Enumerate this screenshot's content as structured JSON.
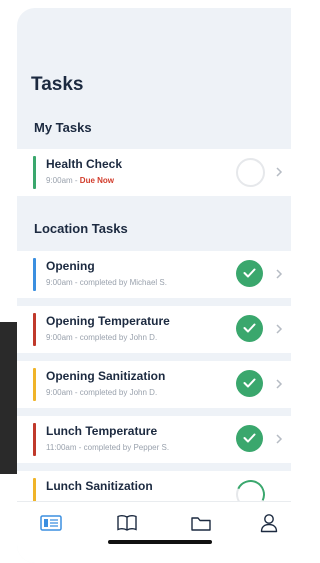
{
  "header": {
    "title": "Tasks"
  },
  "sections": {
    "my_tasks": {
      "title": "My Tasks",
      "items": [
        {
          "name": "Health Check",
          "time": "9:00am",
          "separator": " - ",
          "status_text": "Due Now",
          "status": "empty",
          "accent": "#3aa76d"
        }
      ]
    },
    "location_tasks": {
      "title": "Location Tasks",
      "items": [
        {
          "name": "Opening",
          "time": "9:00am",
          "detail": " - completed by Michael S.",
          "status": "done",
          "accent": "#3b8fe0"
        },
        {
          "name": "Opening Temperature",
          "time": "9:00am",
          "detail": " - completed by John D.",
          "status": "done",
          "accent": "#c0392b"
        },
        {
          "name": "Opening Sanitization",
          "time": "9:00am",
          "detail": " - completed by John D.",
          "status": "done",
          "accent": "#f0b429"
        },
        {
          "name": "Lunch Temperature",
          "time": "11:00am",
          "detail": " - completed by Pepper S.",
          "status": "done",
          "accent": "#c0392b"
        },
        {
          "name": "Lunch Sanitization",
          "time": "",
          "detail": "",
          "status": "partial",
          "accent": "#f0b429"
        }
      ]
    }
  },
  "tabbar": {
    "items": [
      {
        "icon": "checklist-icon",
        "active": true
      },
      {
        "icon": "book-icon",
        "active": false
      },
      {
        "icon": "folder-icon",
        "active": false
      },
      {
        "icon": "profile-icon",
        "active": false
      }
    ]
  },
  "colors": {
    "active_tab": "#3b8fe0",
    "inactive_tab": "#1c2a40",
    "done_green": "#3aa76d",
    "due_red": "#d23c2b"
  }
}
